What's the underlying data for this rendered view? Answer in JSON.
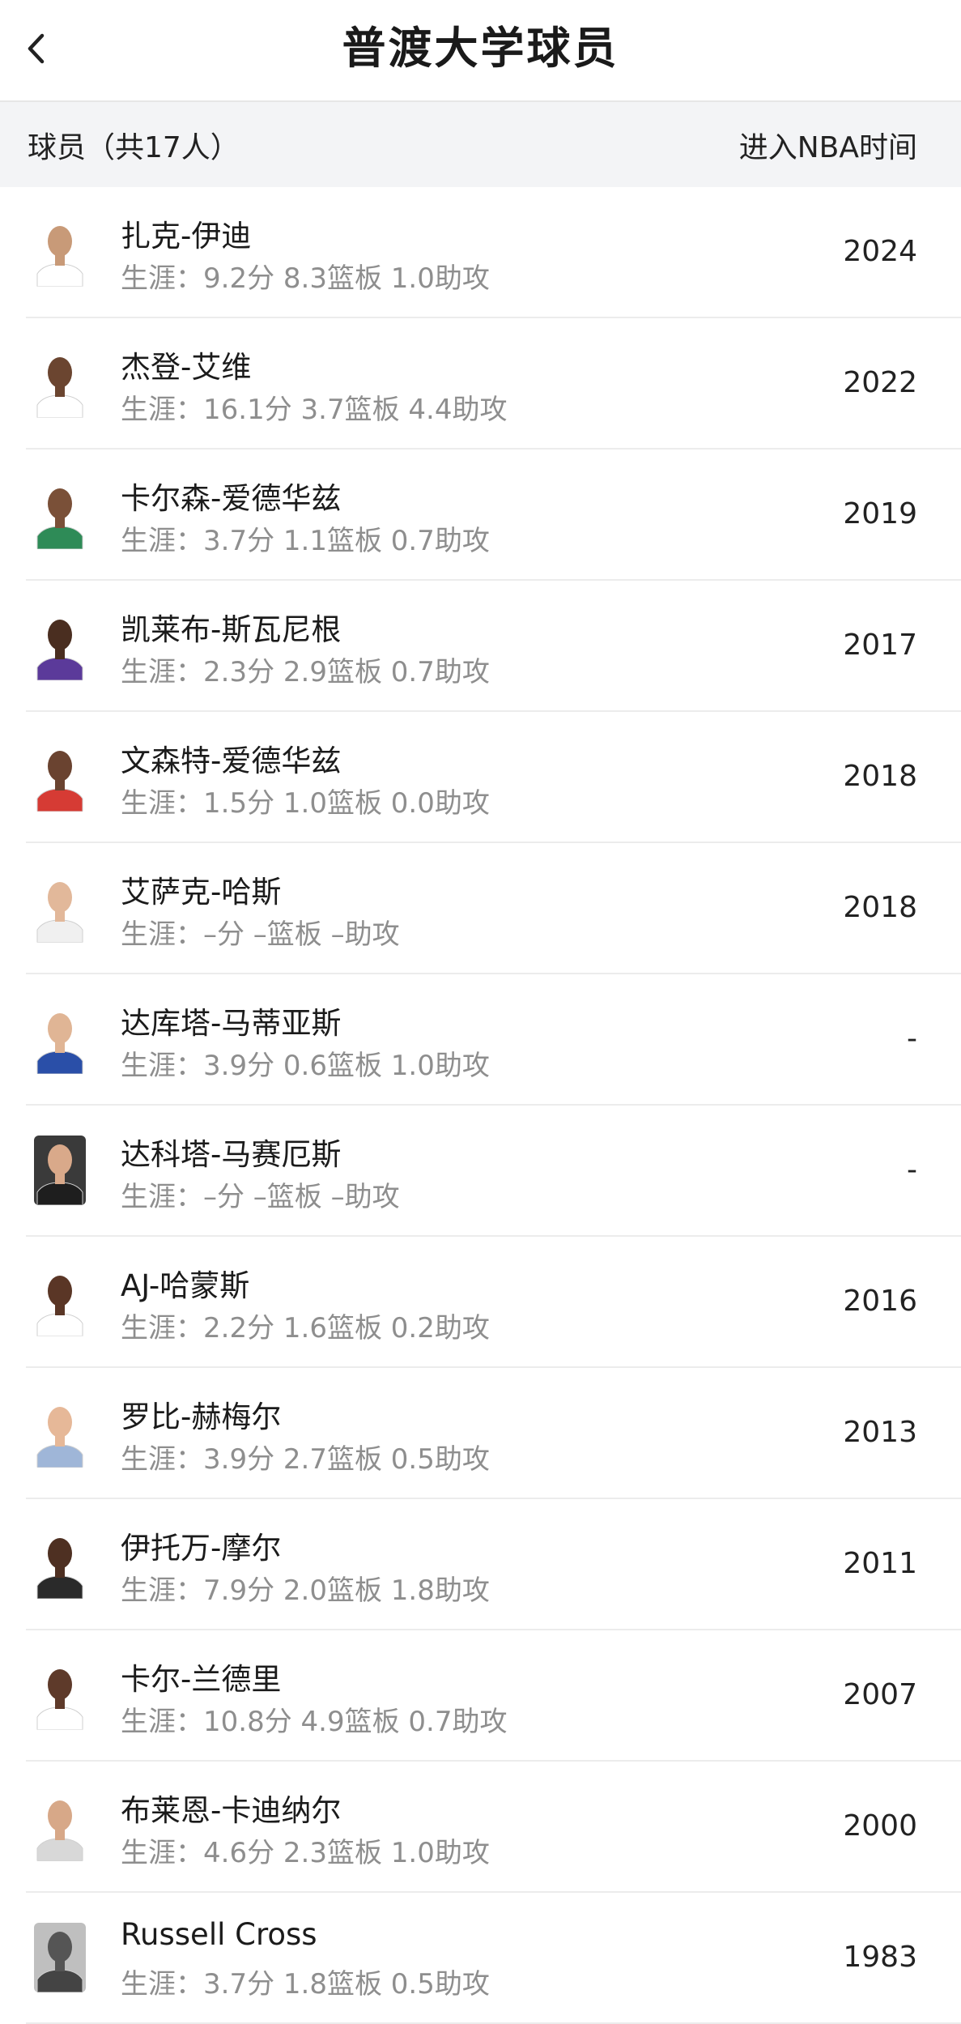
{
  "nav": {
    "title": "普渡大学球员",
    "back_icon": "chevron-left-icon"
  },
  "header": {
    "left": "球员（共17人）",
    "right": "进入NBA时间"
  },
  "players": [
    {
      "name": "扎克-伊迪",
      "stats": "生涯：9.2分 8.3篮板 1.0助攻",
      "year": "2024",
      "jersey": "#ffffff",
      "skin": "#c89a78",
      "bg": "#ffffff"
    },
    {
      "name": "杰登-艾维",
      "stats": "生涯：16.1分 3.7篮板 4.4助攻",
      "year": "2022",
      "jersey": "#ffffff",
      "skin": "#6b4530",
      "bg": "#ffffff"
    },
    {
      "name": "卡尔森-爱德华兹",
      "stats": "生涯：3.7分 1.1篮板 0.7助攻",
      "year": "2019",
      "jersey": "#2e8b57",
      "skin": "#7a5038",
      "bg": "#ffffff"
    },
    {
      "name": "凯莱布-斯瓦尼根",
      "stats": "生涯：2.3分 2.9篮板 0.7助攻",
      "year": "2017",
      "jersey": "#5b3a9a",
      "skin": "#4a2e20",
      "bg": "#ffffff"
    },
    {
      "name": "文森特-爱德华兹",
      "stats": "生涯：1.5分 1.0篮板 0.0助攻",
      "year": "2018",
      "jersey": "#d63b34",
      "skin": "#6a4330",
      "bg": "#ffffff"
    },
    {
      "name": "艾萨克-哈斯",
      "stats": "生涯：–分 –篮板 –助攻",
      "year": "2018",
      "jersey": "#f0f0f0",
      "skin": "#e2b89a",
      "bg": "#ffffff"
    },
    {
      "name": "达库塔-马蒂亚斯",
      "stats": "生涯：3.9分 0.6篮板 1.0助攻",
      "year": "-",
      "jersey": "#2a4fa8",
      "skin": "#e0b595",
      "bg": "#ffffff"
    },
    {
      "name": "达科塔-马赛厄斯",
      "stats": "生涯：–分 –篮板 –助攻",
      "year": "-",
      "jersey": "#1e1e1e",
      "skin": "#d9a98a",
      "bg": "#3a3a3a"
    },
    {
      "name": "AJ-哈蒙斯",
      "stats": "生涯：2.2分 1.6篮板 0.2助攻",
      "year": "2016",
      "jersey": "#ffffff",
      "skin": "#5a3626",
      "bg": "#ffffff"
    },
    {
      "name": "罗比-赫梅尔",
      "stats": "生涯：3.9分 2.7篮板 0.5助攻",
      "year": "2013",
      "jersey": "#9fb6d8",
      "skin": "#e6b898",
      "bg": "#ffffff"
    },
    {
      "name": "伊托万-摩尔",
      "stats": "生涯：7.9分 2.0篮板 1.8助攻",
      "year": "2011",
      "jersey": "#2a2a2a",
      "skin": "#4e3022",
      "bg": "#ffffff"
    },
    {
      "name": "卡尔-兰德里",
      "stats": "生涯：10.8分 4.9篮板 0.7助攻",
      "year": "2007",
      "jersey": "#ffffff",
      "skin": "#5e3a2a",
      "bg": "#ffffff"
    },
    {
      "name": "布莱恩-卡迪纳尔",
      "stats": "生涯：4.6分 2.3篮板 1.0助攻",
      "year": "2000",
      "jersey": "#d8d8d8",
      "skin": "#d7a888",
      "bg": "#ffffff"
    },
    {
      "name": "Russell Cross",
      "stats": "生涯：3.7分 1.8篮板 0.5助攻",
      "year": "1983",
      "jersey": "#444444",
      "skin": "#555555",
      "bg": "#bfbfbf"
    }
  ]
}
